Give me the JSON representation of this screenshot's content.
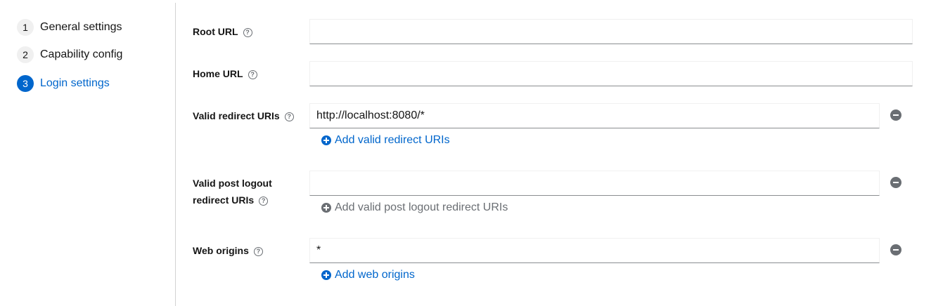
{
  "wizard": {
    "steps": [
      {
        "number": "1",
        "label": "General settings"
      },
      {
        "number": "2",
        "label": "Capability config"
      },
      {
        "number": "3",
        "label": "Login settings"
      }
    ],
    "current_step": "3"
  },
  "form": {
    "root_url": {
      "label": "Root URL",
      "value": ""
    },
    "home_url": {
      "label": "Home URL",
      "value": ""
    },
    "valid_redirect_uris": {
      "label": "Valid redirect URIs",
      "values": [
        "http://localhost:8080/*"
      ],
      "add_label": "Add valid redirect URIs"
    },
    "valid_post_logout_redirect_uris": {
      "label_line1": "Valid post logout",
      "label_line2": "redirect URIs",
      "values": [
        ""
      ],
      "add_label": "Add valid post logout redirect URIs"
    },
    "web_origins": {
      "label": "Web origins",
      "values": [
        "*"
      ],
      "add_label": "Add web origins"
    }
  },
  "icons": {
    "help": "help-icon",
    "remove": "minus-circle-icon",
    "add": "plus-circle-icon"
  },
  "colors": {
    "accent": "#0066cc",
    "muted": "#6a6e73",
    "divider": "#d2d2d2"
  }
}
